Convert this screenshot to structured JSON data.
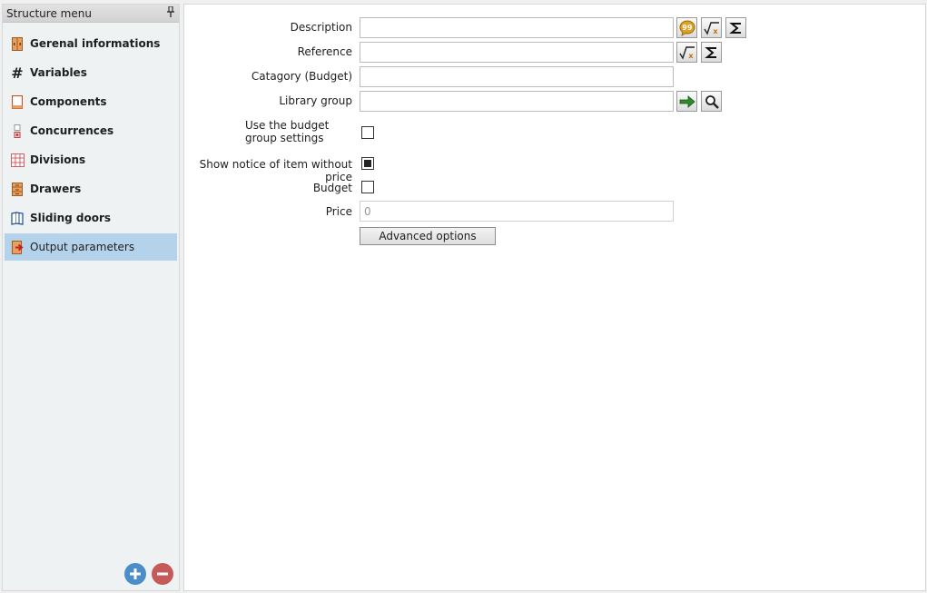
{
  "sidebar": {
    "title": "Structure menu",
    "pin_icon": "pin-icon",
    "items": [
      {
        "label": "Gerenal informations",
        "icon": "cabinet-icon"
      },
      {
        "label": "Variables",
        "icon": "hash-icon"
      },
      {
        "label": "Components",
        "icon": "panel-icon"
      },
      {
        "label": "Concurrences",
        "icon": "concurrence-icon"
      },
      {
        "label": "Divisions",
        "icon": "grid-icon"
      },
      {
        "label": "Drawers",
        "icon": "drawers-icon"
      },
      {
        "label": "Sliding doors",
        "icon": "sliding-doors-icon"
      },
      {
        "label": "Output parameters",
        "icon": "output-icon"
      }
    ],
    "active_item": "Output parameters",
    "add_icon": "plus-icon",
    "remove_icon": "minus-icon"
  },
  "form": {
    "description": {
      "label": "Description",
      "value": ""
    },
    "reference": {
      "label": "Reference",
      "value": ""
    },
    "category": {
      "label": "Catagory (Budget)",
      "value": ""
    },
    "library_group": {
      "label": "Library group",
      "value": ""
    },
    "use_budget_group": {
      "label": "Use the budget group settings",
      "checked": false
    },
    "show_notice": {
      "label": "Show notice of item without price",
      "checked": true
    },
    "budget": {
      "label": "Budget",
      "checked": false
    },
    "price": {
      "label": "Price",
      "value": "0"
    },
    "advanced_label": "Advanced options"
  },
  "colors": {
    "active_item": "#b4d2ea",
    "add_button": "#4a8dc8",
    "remove_button": "#c65a5a",
    "arrow_green": "#2e8b2e",
    "speech_orange": "#e0a020"
  }
}
